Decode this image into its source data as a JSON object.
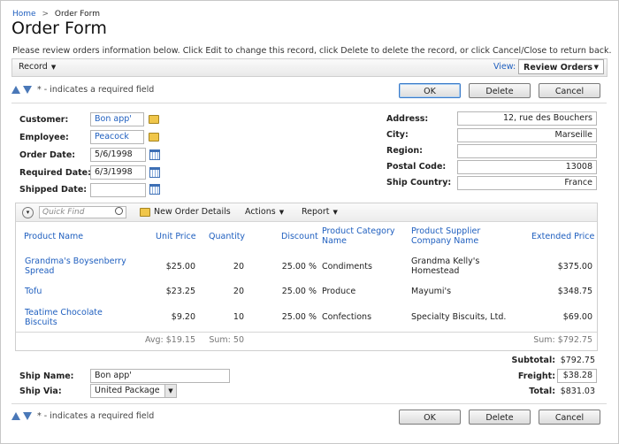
{
  "breadcrumb": {
    "home": "Home",
    "separator": ">",
    "current": "Order Form"
  },
  "page_title": "Order Form",
  "description": "Please review orders information below. Click Edit to change this record, click Delete to delete the record, or click Cancel/Close to return back.",
  "toolbar": {
    "record_label": "Record",
    "view_label": "View:",
    "view_value": "Review Orders"
  },
  "required_note": "* - indicates a required field",
  "buttons": {
    "ok": "OK",
    "delete": "Delete",
    "cancel": "Cancel"
  },
  "form": {
    "customer": {
      "label": "Customer:",
      "value": "Bon app'"
    },
    "employee": {
      "label": "Employee:",
      "value": "Peacock"
    },
    "order_date": {
      "label": "Order Date:",
      "value": "5/6/1998"
    },
    "required_date": {
      "label": "Required Date:",
      "value": "6/3/1998"
    },
    "shipped_date": {
      "label": "Shipped Date:",
      "value": ""
    },
    "address": {
      "label": "Address:",
      "value": "12, rue des Bouchers"
    },
    "city": {
      "label": "City:",
      "value": "Marseille"
    },
    "region": {
      "label": "Region:",
      "value": ""
    },
    "postal_code": {
      "label": "Postal Code:",
      "value": "13008"
    },
    "ship_country": {
      "label": "Ship Country:",
      "value": "France"
    }
  },
  "details": {
    "quick_find_placeholder": "Quick Find",
    "new_button": "New Order Details",
    "actions": "Actions",
    "report": "Report",
    "columns": [
      "Product Name",
      "Unit Price",
      "Quantity",
      "Discount",
      "Product Category Name",
      "Product Supplier Company Name",
      "Extended Price"
    ],
    "rows": [
      {
        "product": "Grandma's Boysenberry Spread",
        "unit_price": "$25.00",
        "quantity": "20",
        "discount": "25.00 %",
        "category": "Condiments",
        "supplier": "Grandma Kelly's Homestead",
        "extended": "$375.00"
      },
      {
        "product": "Tofu",
        "unit_price": "$23.25",
        "quantity": "20",
        "discount": "25.00 %",
        "category": "Produce",
        "supplier": "Mayumi's",
        "extended": "$348.75"
      },
      {
        "product": "Teatime Chocolate Biscuits",
        "unit_price": "$9.20",
        "quantity": "10",
        "discount": "25.00 %",
        "category": "Confections",
        "supplier": "Specialty Biscuits, Ltd.",
        "extended": "$69.00"
      }
    ],
    "footer": {
      "avg": "Avg: $19.15",
      "sum_qty": "Sum: 50",
      "sum_ext": "Sum: $792.75"
    }
  },
  "totals": {
    "subtotal_label": "Subtotal:",
    "subtotal": "$792.75",
    "freight_label": "Freight:",
    "freight": "$38.28",
    "total_label": "Total:",
    "total": "$831.03"
  },
  "ship": {
    "name_label": "Ship Name:",
    "name_value": "Bon app'",
    "via_label": "Ship Via:",
    "via_value": "United Package"
  }
}
